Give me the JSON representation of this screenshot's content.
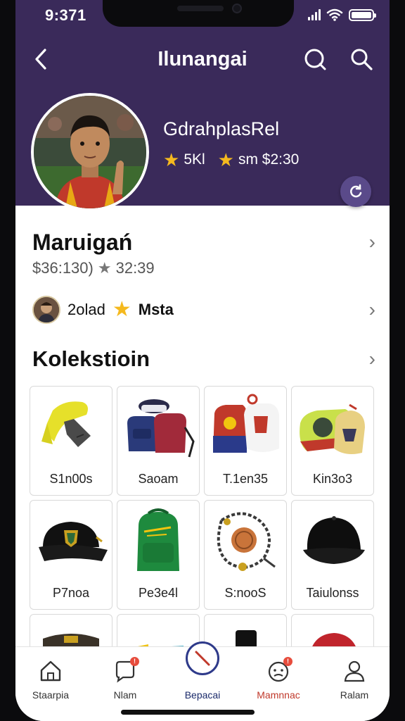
{
  "status": {
    "time": "9:371"
  },
  "nav": {
    "title": "Ilunangai"
  },
  "profile": {
    "name": "GdrahplasRel",
    "stat1": "5Kl",
    "stat2": "sm $2:30"
  },
  "section1": {
    "title": "Maruigań",
    "subtitle_price": "$36:130)",
    "subtitle_rating": "32:39",
    "user_count": "2olad",
    "user_tag": "Msta"
  },
  "collection": {
    "title": "Kolekstioin",
    "items": [
      {
        "label": "S1n00s",
        "icon": "scarf-icon"
      },
      {
        "label": "Saoam",
        "icon": "bags-icon"
      },
      {
        "label": "T.1en35",
        "icon": "jersey-tags-icon"
      },
      {
        "label": "Kin3o3",
        "icon": "pennant-icon"
      },
      {
        "label": "P7noa",
        "icon": "cap-icon"
      },
      {
        "label": "Pe3e4l",
        "icon": "backpack-icon"
      },
      {
        "label": "S:nooS",
        "icon": "bracelet-icon"
      },
      {
        "label": "Taiulonss",
        "icon": "black-cap-icon"
      }
    ]
  },
  "tabs": [
    {
      "label": "Staarpia",
      "icon": "home-icon"
    },
    {
      "label": "Nlam",
      "icon": "chat-icon",
      "badge": "!"
    },
    {
      "label": "Bepacai",
      "icon": "center-icon"
    },
    {
      "label": "Mamnnac",
      "icon": "notification-face-icon",
      "badge": "!"
    },
    {
      "label": "Ralam",
      "icon": "profile-icon"
    }
  ],
  "colors": {
    "header_bg": "#3a2a5a",
    "accent_red": "#c0392b",
    "star": "#f5b91e",
    "center_ring": "#2e3a8a"
  }
}
